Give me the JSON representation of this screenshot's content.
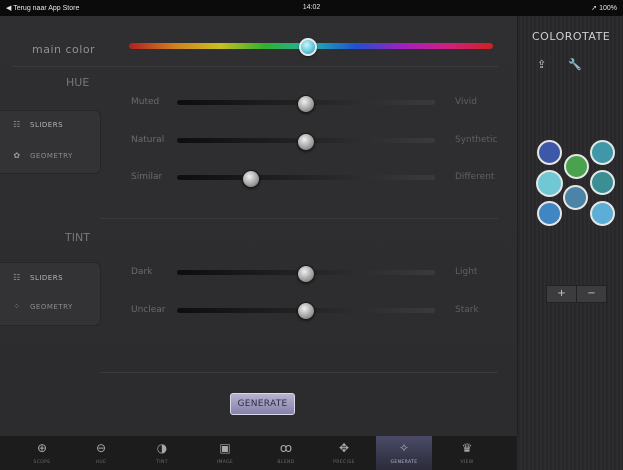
{
  "status": {
    "left": "◀ Terug naar App Store",
    "time": "14:02",
    "right": "➚ 100%"
  },
  "main_color": {
    "label": "main color"
  },
  "hue": {
    "title": "HUE",
    "modes": [
      {
        "label": "SLIDERS",
        "icon": "sliders-icon"
      },
      {
        "label": "GEOMETRY",
        "icon": "flower-icon"
      }
    ],
    "sliders": [
      {
        "left": "Muted",
        "right": "Vivid",
        "value": 0.51
      },
      {
        "left": "Natural",
        "right": "Synthetic",
        "value": 0.51
      },
      {
        "left": "Similar",
        "right": "Different",
        "value": 0.28
      }
    ]
  },
  "tint": {
    "title": "TINT",
    "modes": [
      {
        "label": "SLIDERS",
        "icon": "sliders-icon"
      },
      {
        "label": "GEOMETRY",
        "icon": "dots-icon"
      }
    ],
    "sliders": [
      {
        "left": "Dark",
        "right": "Light",
        "value": 0.51
      },
      {
        "left": "Unclear",
        "right": "Stark",
        "value": 0.51
      }
    ]
  },
  "generate": {
    "label": "GENERATE"
  },
  "app": {
    "title": "COLOROTATE"
  },
  "swatches": [
    {
      "color": "#3e58a8"
    },
    {
      "color": "#4aa14e"
    },
    {
      "color": "#3f97a7"
    },
    {
      "color": "#6fc8d4"
    },
    {
      "color": "#4b84a6"
    },
    {
      "color": "#3b8f94"
    },
    {
      "color": "#3f86c2"
    },
    {
      "color": "#5daed6"
    }
  ],
  "controls": {
    "plus": "+",
    "minus": "−"
  },
  "tabs": [
    {
      "label": "SCOPE",
      "icon": "scope-icon"
    },
    {
      "label": "HUE",
      "icon": "hue-icon"
    },
    {
      "label": "TINT",
      "icon": "tint-icon"
    },
    {
      "label": "IMAGE",
      "icon": "image-icon"
    },
    {
      "label": "BLEND",
      "icon": "blend-icon"
    },
    {
      "label": "PRECISE",
      "icon": "precise-icon"
    },
    {
      "label": "GENERATE",
      "icon": "generate-icon"
    },
    {
      "label": "VIEW",
      "icon": "view-icon"
    }
  ]
}
